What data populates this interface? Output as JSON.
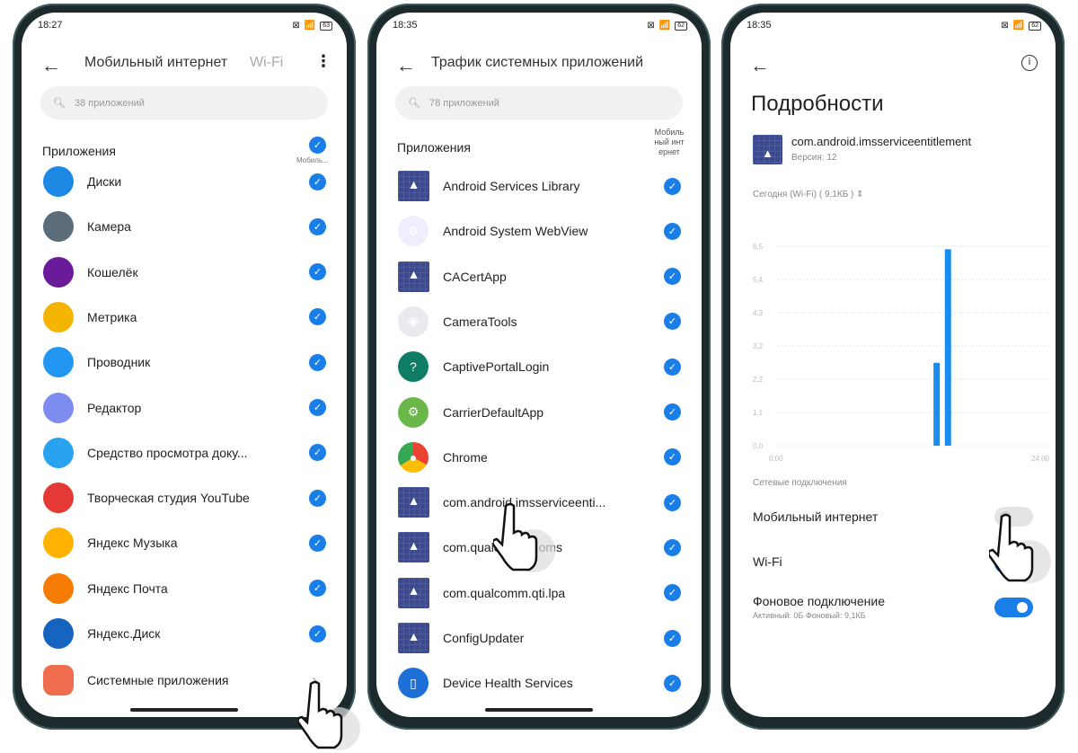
{
  "phone1": {
    "time": "18:27",
    "battery": "63",
    "back_icon": "arrow-left",
    "tab_mobile": "Мобильный интернет",
    "tab_wifi": "Wi-Fi",
    "menu_icon": "more-vertical",
    "search_placeholder": "38 приложений",
    "section": "Приложения",
    "column_label": "Мобиль...",
    "apps": [
      {
        "name": "Диски",
        "color": "#1e88e5",
        "checked": true
      },
      {
        "name": "Камера",
        "color": "#5a6b7a",
        "checked": true
      },
      {
        "name": "Кошелёк",
        "color": "#6a1b9a",
        "checked": true
      },
      {
        "name": "Метрика",
        "color": "#f4b400",
        "checked": true
      },
      {
        "name": "Проводник",
        "color": "#2196f3",
        "checked": true
      },
      {
        "name": "Редактор",
        "color": "#7e8cf0",
        "checked": true
      },
      {
        "name": "Средство просмотра доку...",
        "color": "#29a3f0",
        "checked": true
      },
      {
        "name": "Творческая студия YouTube",
        "color": "#e53935",
        "checked": true
      },
      {
        "name": "Яндекс Музыка",
        "color": "#ffb300",
        "checked": true
      },
      {
        "name": "Яндекс Почта",
        "color": "#f57c00",
        "checked": true
      },
      {
        "name": "Яндекс.Диск",
        "color": "#1565c0",
        "checked": true
      }
    ],
    "system_apps": {
      "name": "Системные приложения",
      "color": "#ef6c4f",
      "chevron": "›"
    }
  },
  "phone2": {
    "time": "18:35",
    "battery": "62",
    "title": "Трафик системных приложений",
    "search_placeholder": "78 приложений",
    "section": "Приложения",
    "column_label": "Мобиль ный инт ернет",
    "apps": [
      {
        "name": "Android Services Library",
        "icon": "android",
        "checked": true
      },
      {
        "name": "Android System WebView",
        "icon": "gear",
        "checked": true
      },
      {
        "name": "CACertApp",
        "icon": "android",
        "checked": true
      },
      {
        "name": "CameraTools",
        "icon": "camera",
        "checked": true
      },
      {
        "name": "CaptivePortalLogin",
        "icon": "wifi-question",
        "checked": true
      },
      {
        "name": "CarrierDefaultApp",
        "icon": "gear-green",
        "checked": true
      },
      {
        "name": "Chrome",
        "icon": "chrome",
        "checked": true
      },
      {
        "name": "com.android.imsserviceenti...",
        "icon": "android",
        "checked": true
      },
      {
        "name": "com.qualcomm...oms",
        "icon": "android",
        "checked": true
      },
      {
        "name": "com.qualcomm.qti.lpa",
        "icon": "android",
        "checked": true
      },
      {
        "name": "ConfigUpdater",
        "icon": "android",
        "checked": true
      },
      {
        "name": "Device Health Services",
        "icon": "device-health",
        "checked": true
      }
    ]
  },
  "phone3": {
    "time": "18:35",
    "battery": "62",
    "title": "Подробности",
    "app_name": "com.android.imsserviceentitlement",
    "version": "Версия: 12",
    "period_label": "Сегодня (Wi-Fi) ( 9,1КБ )",
    "network_section": "Сетевые подключения",
    "toggles": [
      {
        "label": "Мобильный интернет",
        "on": false
      },
      {
        "label": "Wi-Fi",
        "on": true
      },
      {
        "label": "Фоновое подключение",
        "sub": "Активный: 0Б  Фоновый: 9,1КБ",
        "on": true
      }
    ]
  },
  "accent": "#1a7ee8",
  "chart_data": {
    "type": "bar",
    "x_ticks": [
      "0:00",
      "24:00"
    ],
    "y_ticks": [
      "0,0",
      "1,1",
      "2,2",
      "3,2",
      "4,3",
      "5,4",
      "6,5"
    ],
    "ylim": [
      0,
      6.5
    ],
    "xlim": [
      0,
      24
    ],
    "grid": true,
    "x": [
      14,
      15
    ],
    "values": [
      2.7,
      6.4
    ],
    "color": "#1a8cf0"
  }
}
